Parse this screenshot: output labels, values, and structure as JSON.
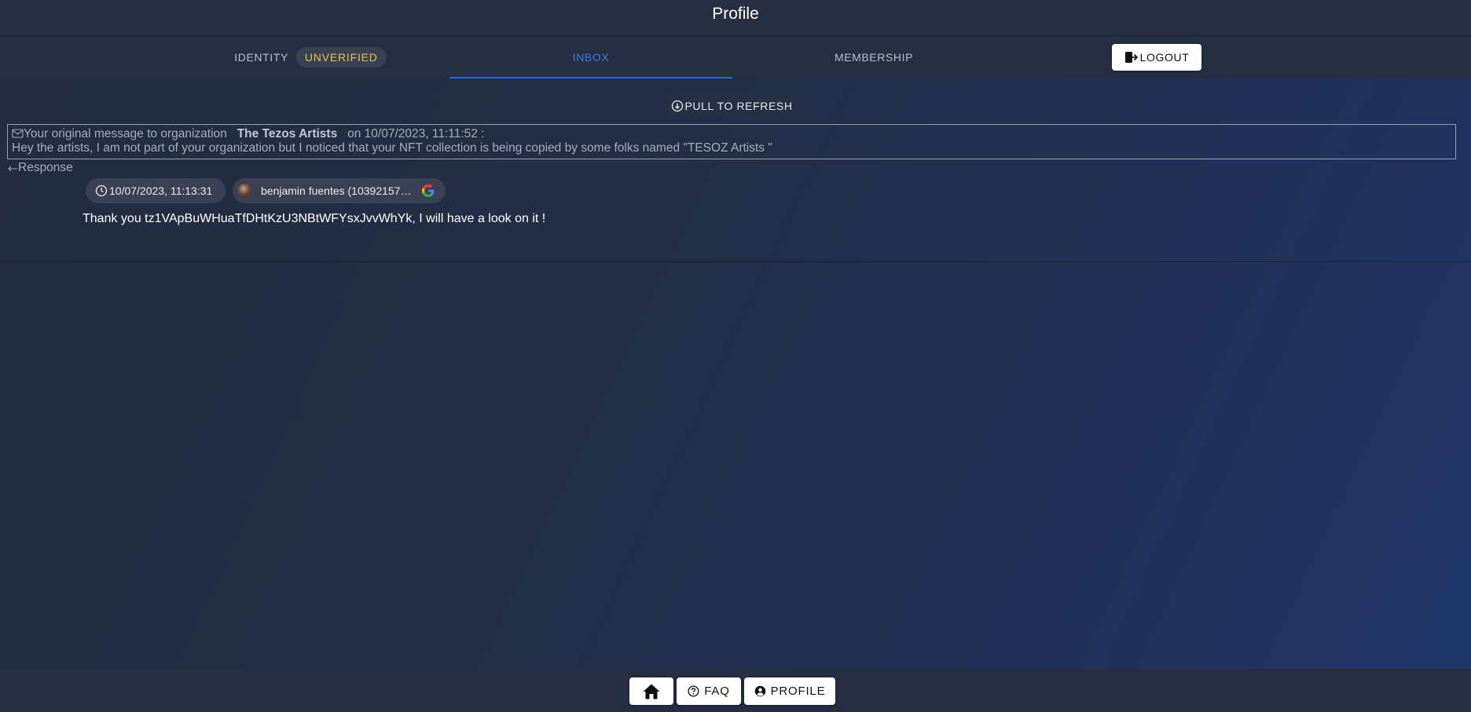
{
  "header": {
    "title": "Profile"
  },
  "tabs": {
    "identity_label": "IDENTITY",
    "identity_status": "UNVERIFIED",
    "inbox_label": "INBOX",
    "membership_label": "MEMBERSHIP",
    "logout_label": "LOGOUT"
  },
  "refresh": {
    "label": "PULL TO REFRESH"
  },
  "original_message": {
    "prefix": "Your original message to organization",
    "organization": "The Tezos Artists",
    "date_text": "on 10/07/2023, 11:11:52 :",
    "body": "Hey the artists, I am not part of your organization but I noticed that your NFT collection is being copied by some folks named \"TESOZ Artists \""
  },
  "response": {
    "label": "Response",
    "timestamp": "10/07/2023, 11:13:31",
    "author": "benjamin fuentes (103921570...",
    "text": "Thank you tz1VApBuWHuaTfDHtKzU3NBtWFYsxJvvWhYk, I will have a look on it !"
  },
  "footer": {
    "faq_label": "FAQ",
    "profile_label": "PROFILE"
  },
  "colors": {
    "accent": "#1f6ddf",
    "unverified": "#e1c34a",
    "background": "#252e42"
  },
  "icons": [
    "logout-icon",
    "arrow-down-circle-icon",
    "envelope-icon",
    "reply-arrow-icon",
    "clock-icon",
    "google-icon",
    "home-icon",
    "help-circle-icon",
    "user-circle-icon"
  ]
}
